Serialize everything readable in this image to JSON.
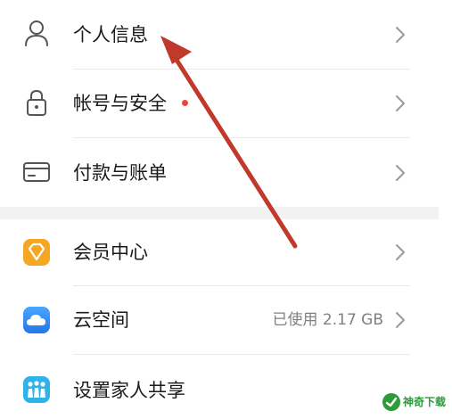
{
  "settings": {
    "group1": [
      {
        "label": "个人信息",
        "icon": "person-icon"
      },
      {
        "label": "帐号与安全",
        "icon": "lock-icon",
        "badge": "red-dot"
      },
      {
        "label": "付款与账单",
        "icon": "card-icon"
      }
    ],
    "group2": [
      {
        "label": "会员中心",
        "icon": "membership-diamond-icon"
      },
      {
        "label": "云空间",
        "icon": "cloud-icon",
        "value": "已使用 2.17 GB"
      },
      {
        "label": "设置家人共享",
        "icon": "family-sharing-icon"
      }
    ]
  },
  "watermark": {
    "text": "神奇下载"
  },
  "colors": {
    "background": "#ffffff",
    "separator": "#f2f2f2",
    "chevron": "#9a9a9a",
    "badge": "#e5483f",
    "arrow": "#c0392b",
    "membership": "#f5a623",
    "cloud": "#2f8ef5",
    "family": "#2fb3e8"
  }
}
